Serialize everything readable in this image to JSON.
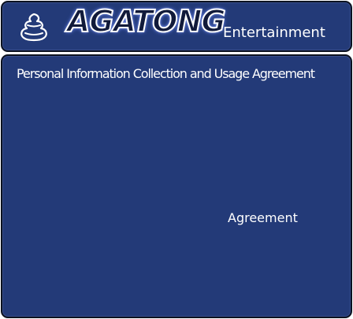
{
  "header": {
    "brand": "AGATONG",
    "subtitle": "Entertainment",
    "logo_icon": "swirl-logo-icon"
  },
  "content": {
    "title": "Personal Information Collection and Usage Agreement",
    "agreement_label": "Agreement"
  },
  "colors": {
    "panel_bg": "#233a78",
    "panel_border": "#0c1220",
    "text": "#ffffff"
  }
}
